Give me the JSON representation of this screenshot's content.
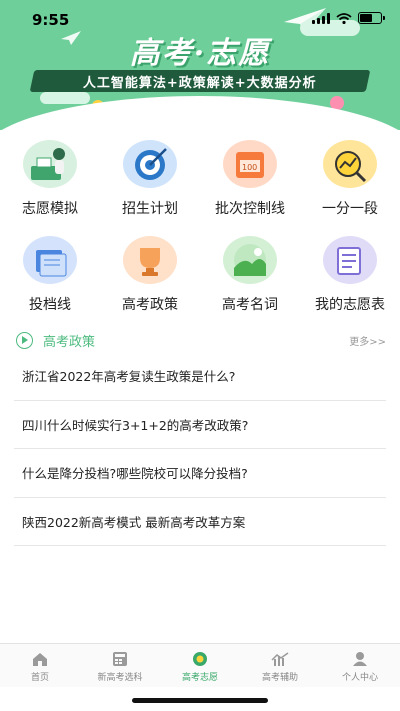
{
  "status_bar": {
    "time": "9:55"
  },
  "banner": {
    "title": "高考·志愿",
    "subtitle": "人工智能算法+政策解读+大数据分析",
    "colors": {
      "background": "#6fcf9b",
      "subtitle_bg": "#1f5a3c"
    }
  },
  "grid": [
    {
      "label": "志愿模拟",
      "icon": "person-desk-icon"
    },
    {
      "label": "招生计划",
      "icon": "target-icon"
    },
    {
      "label": "批次控制线",
      "icon": "score-paper-icon"
    },
    {
      "label": "一分一段",
      "icon": "chart-magnifier-icon"
    },
    {
      "label": "投档线",
      "icon": "file-stack-icon"
    },
    {
      "label": "高考政策",
      "icon": "trophy-cup-icon"
    },
    {
      "label": "高考名词",
      "icon": "landscape-icon"
    },
    {
      "label": "我的志愿表",
      "icon": "document-list-icon"
    }
  ],
  "policy": {
    "title": "高考政策",
    "more": "更多>>",
    "items": [
      "浙江省2022年高考复读生政策是什么?",
      "四川什么时候实行3+1+2的高考改政策?",
      "什么是降分投档?哪些院校可以降分投档?",
      "陕西2022新高考模式 最新高考改革方案"
    ]
  },
  "tabbar": {
    "items": [
      {
        "label": "首页",
        "icon": "home-icon",
        "active": false
      },
      {
        "label": "新高考选科",
        "icon": "grid-calculator-icon",
        "active": false
      },
      {
        "label": "高考志愿",
        "icon": "medal-icon",
        "active": true
      },
      {
        "label": "高考辅助",
        "icon": "bar-chart-icon",
        "active": false
      },
      {
        "label": "个人中心",
        "icon": "user-icon",
        "active": false
      }
    ],
    "active_color": "#3aa86a"
  }
}
